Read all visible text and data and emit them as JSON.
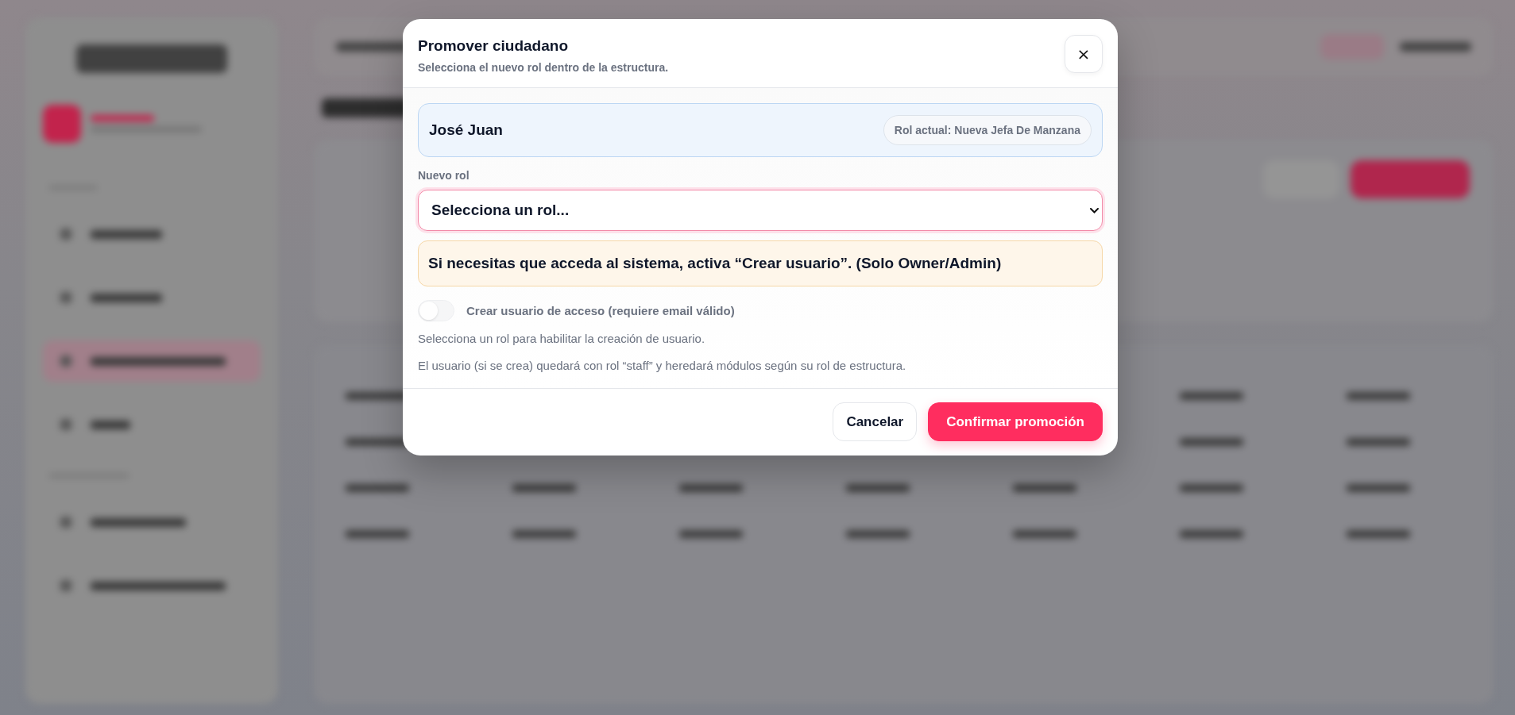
{
  "dialog": {
    "title": "Promover ciudadano",
    "subtitle": "Selecciona el nuevo rol dentro de la estructura.",
    "close_label": "×"
  },
  "person": {
    "name": "José Juan",
    "current_role": "Rol actual: Nueva Jefa De Manzana"
  },
  "role_field": {
    "label": "Nuevo rol",
    "value": "Selecciona un rol...",
    "focused": true
  },
  "notice": "Si necesitas que acceda al sistema, activa “Crear usuario”. (Solo Owner/Admin)",
  "create_user": {
    "label": "Crear usuario de acceso (requiere email válido)",
    "on": false,
    "disabled": true
  },
  "hints": [
    "Selecciona un rol para habilitar la creación de usuario.",
    "El usuario (si se crea) quedará con rol “staff” y heredará módulos según su rol de estructura."
  ],
  "buttons": [
    {
      "label": "Cancelar",
      "kind": "secondary"
    },
    {
      "label": "Confirmar promoción",
      "kind": "primary"
    }
  ]
}
